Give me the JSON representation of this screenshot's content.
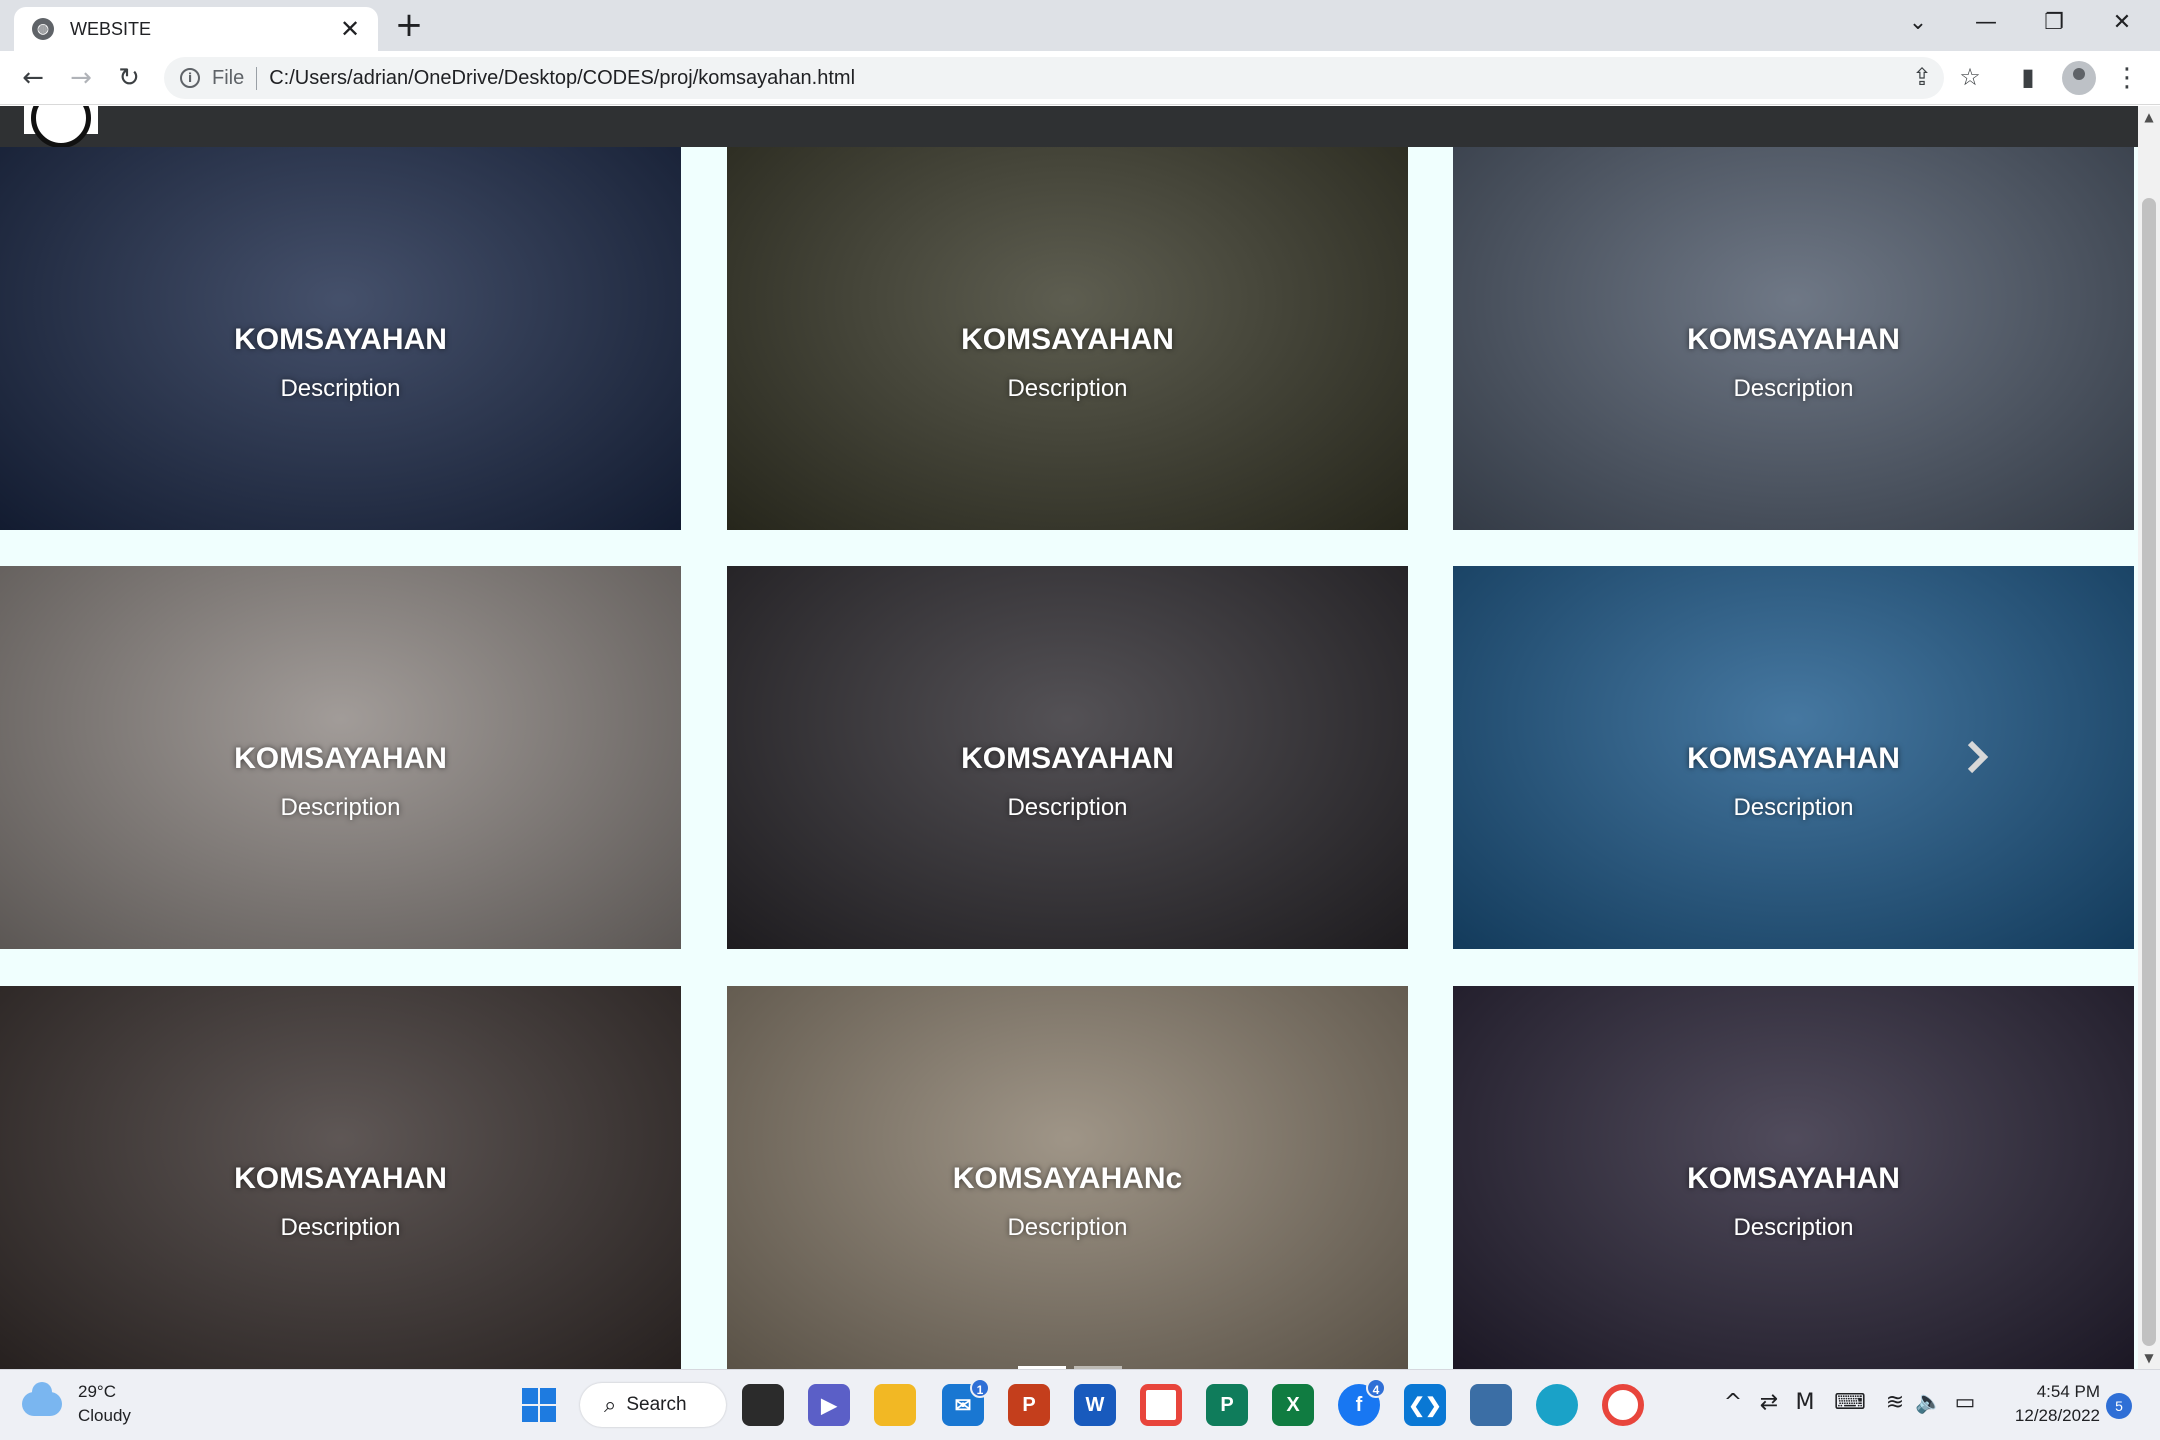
{
  "browser": {
    "tab_title": "WEBSITE",
    "address_scheme": "File",
    "address_url": "C:/Users/adrian/OneDrive/Desktop/CODES/proj/komsayahan.html"
  },
  "gallery": {
    "cards": [
      {
        "title": "KOMSAYAHAN",
        "description": "Description",
        "bg": "#1c2a4a"
      },
      {
        "title": "KOMSAYAHAN",
        "description": "Description",
        "bg": "#3a3a2a"
      },
      {
        "title": "KOMSAYAHAN",
        "description": "Description",
        "bg": "#4f5a6b"
      },
      {
        "title": "KOMSAYAHAN",
        "description": "Description",
        "bg": "#8d8682"
      },
      {
        "title": "KOMSAYAHAN",
        "description": "Description",
        "bg": "#2e2b30"
      },
      {
        "title": "KOMSAYAHAN",
        "description": "Description",
        "bg": "#1d5a8c"
      },
      {
        "title": "KOMSAYAHAN",
        "description": "Description",
        "bg": "#3b3230"
      },
      {
        "title": "KOMSAYAHANc",
        "description": "Description",
        "bg": "#8a7e6d"
      },
      {
        "title": "KOMSAYAHAN",
        "description": "Description",
        "bg": "#2a2438"
      }
    ]
  },
  "taskbar": {
    "weather_temp": "29°C",
    "weather_desc": "Cloudy",
    "search_label": "Search",
    "mail_badge": "1",
    "messenger_badge": "4",
    "time": "4:54 PM",
    "date": "12/28/2022",
    "notifications": "5"
  },
  "colors": {
    "page_bg": "#f0fffe",
    "site_header": "#2f3133",
    "accent": "#2f6fd6"
  }
}
